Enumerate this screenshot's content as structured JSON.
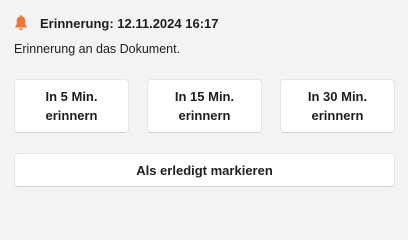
{
  "notification": {
    "icon": "bell-icon",
    "accent_color": "#e8793a",
    "title": "Erinnerung: 12.11.2024 16:17",
    "message": "Erinnerung an das Dokument."
  },
  "actions": {
    "snooze": [
      {
        "line1": "In 5 Min.",
        "line2": "erinnern"
      },
      {
        "line1": "In 15 Min.",
        "line2": "erinnern"
      },
      {
        "line1": "In 30 Min.",
        "line2": "erinnern"
      }
    ],
    "done_label": "Als erledigt markieren"
  }
}
